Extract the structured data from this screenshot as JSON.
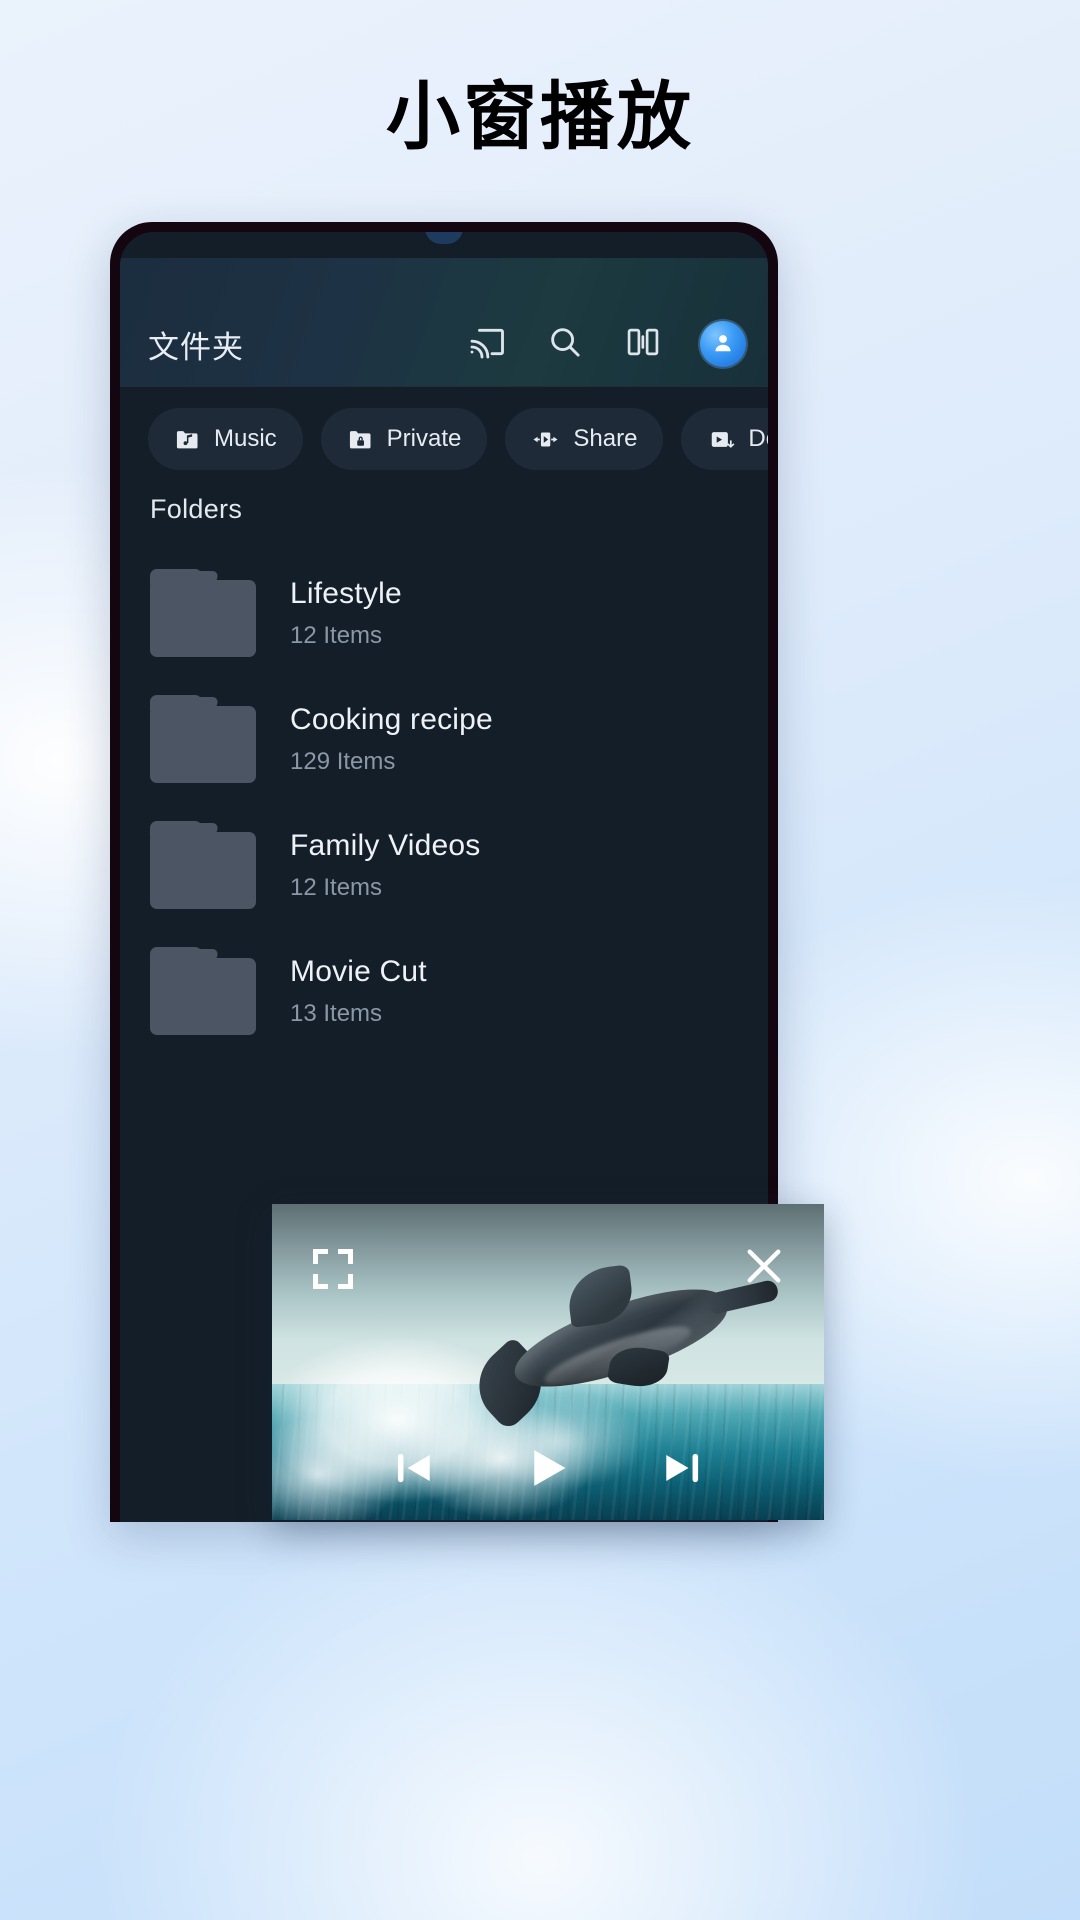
{
  "page": {
    "title": "小窗播放"
  },
  "app": {
    "header": {
      "title": "文件夹",
      "actions": [
        {
          "icon": "cast-icon",
          "label": "Cast"
        },
        {
          "icon": "search-icon",
          "label": "Search"
        },
        {
          "icon": "equalizer-icon",
          "label": "Equalizer"
        },
        {
          "icon": "avatar-icon",
          "label": "Profile"
        }
      ]
    },
    "chips": [
      {
        "label": "Music",
        "icon": "music-folder-icon"
      },
      {
        "label": "Private",
        "icon": "lock-folder-icon"
      },
      {
        "label": "Share",
        "icon": "share-play-icon"
      },
      {
        "label": "Downloaded",
        "icon": "download-play-icon"
      }
    ],
    "section_label": "Folders",
    "folders": [
      {
        "name": "Lifestyle",
        "count": "12 Items"
      },
      {
        "name": "Cooking recipe",
        "count": "129 Items"
      },
      {
        "name": "Family Videos",
        "count": "12 Items"
      },
      {
        "name": "Movie Cut",
        "count": "13 Items"
      }
    ],
    "pip": {
      "expand_label": "Fullscreen",
      "close_label": "Close",
      "controls": [
        {
          "icon": "previous-icon",
          "label": "Previous"
        },
        {
          "icon": "play-icon",
          "label": "Play"
        },
        {
          "icon": "next-icon",
          "label": "Next"
        }
      ]
    }
  },
  "colors": {
    "accent": "#3a9bf5",
    "screen_bg": "#141e28",
    "chip_bg": "#1e2a38",
    "folder_icon": "#4b5563",
    "text_primary": "#eef2f7",
    "text_secondary": "#8a97a6"
  }
}
